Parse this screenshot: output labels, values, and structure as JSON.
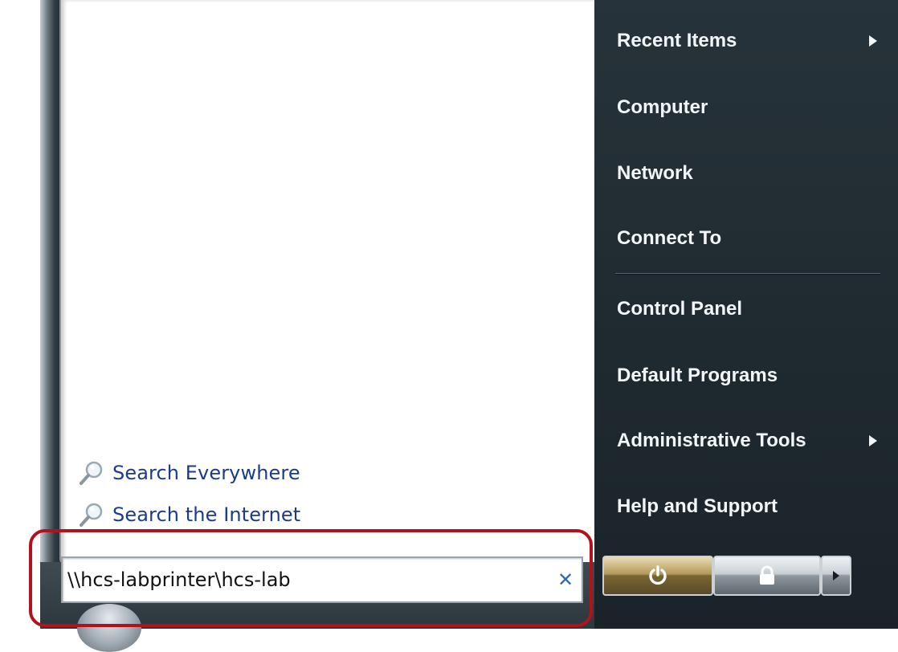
{
  "search_results": {
    "items": [
      {
        "label": "Search Everywhere",
        "icon": "search-icon"
      },
      {
        "label": "Search the Internet",
        "icon": "search-icon"
      }
    ]
  },
  "search": {
    "value": "\\\\hcs-labprinter\\hcs-lab",
    "clear_icon": "close-icon"
  },
  "right_menu": {
    "items": [
      {
        "label": "Recent Items",
        "has_submenu": true
      },
      {
        "label": "Computer"
      },
      {
        "label": "Network"
      },
      {
        "label": "Connect To"
      },
      {
        "label": "Control Panel"
      },
      {
        "label": "Default Programs"
      },
      {
        "label": "Administrative Tools",
        "has_submenu": true
      },
      {
        "label": "Help and Support"
      }
    ]
  },
  "power_buttons": {
    "shutdown_icon": "power-icon",
    "lock_icon": "lock-icon",
    "more_icon": "chevron-right-icon"
  },
  "colors": {
    "highlight": "#b3121c",
    "link": "#1b3b8e",
    "right_pane": "#232e34"
  }
}
